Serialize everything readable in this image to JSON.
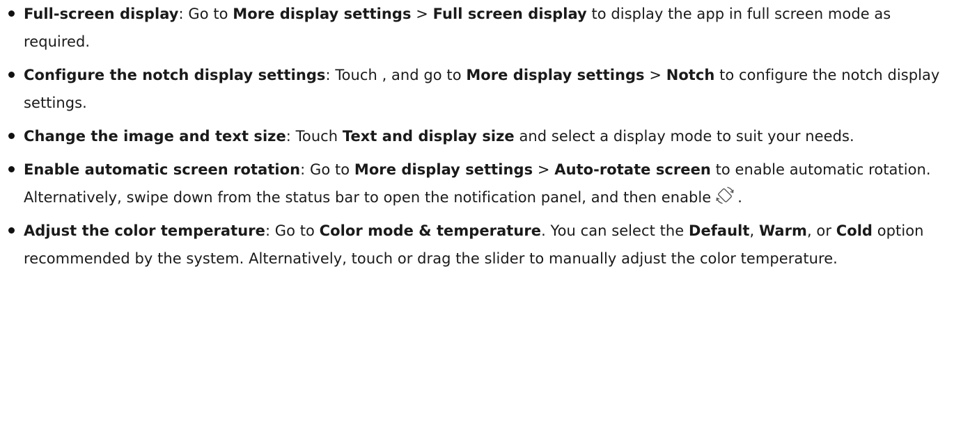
{
  "items": [
    {
      "title": "Full-screen display",
      "t1": ": Go to ",
      "b1": "More display settings",
      "t2": " > ",
      "b2": "Full screen display",
      "t3": " to display the app in full screen mode as required."
    },
    {
      "title": "Configure the notch display settings",
      "t1": ": Touch , and go to ",
      "b1": "More display settings",
      "t2": " > ",
      "b2": "Notch",
      "t3": " to configure the notch display settings."
    },
    {
      "title": "Change the image and text size",
      "t1": ": Touch ",
      "b1": "Text and display size",
      "t2": " and select a display mode to suit your needs."
    },
    {
      "title": "Enable automatic screen rotation",
      "t1": ": Go to ",
      "b1": "More display settings",
      "t2": " > ",
      "b2": "Auto-rotate screen",
      "t3": " to enable automatic rotation. Alternatively, swipe down from the status bar to open the notification panel, and then enable",
      "t4": ".",
      "icon": "auto-rotate-icon"
    },
    {
      "title": "Adjust the color temperature",
      "t1": ": Go to ",
      "b1": "Color mode & temperature",
      "t2": ". You can select the ",
      "b2": "Default",
      "t3": ", ",
      "b3": "Warm",
      "t4": ", or ",
      "b4": "Cold",
      "t5": " option recommended by the system. Alternatively, touch or drag the slider to manually adjust the color temperature."
    }
  ]
}
